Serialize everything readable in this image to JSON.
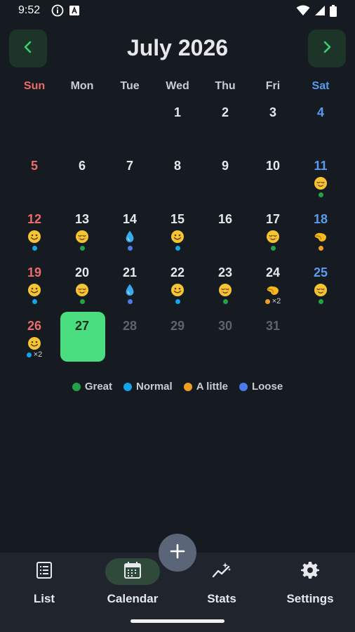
{
  "status": {
    "time": "9:52"
  },
  "header": {
    "title": "July 2026"
  },
  "weekdays": [
    "Sun",
    "Mon",
    "Tue",
    "Wed",
    "Thu",
    "Fri",
    "Sat"
  ],
  "colors": {
    "great": "#22a34a",
    "normal": "#14a5e8",
    "a_little": "#f0a020",
    "loose": "#4a7cf0",
    "today": "#4ade80"
  },
  "days": [
    {
      "day": "",
      "dow": 0
    },
    {
      "day": "",
      "dow": 1
    },
    {
      "day": "",
      "dow": 2
    },
    {
      "day": "1",
      "dow": 3
    },
    {
      "day": "2",
      "dow": 4
    },
    {
      "day": "3",
      "dow": 5
    },
    {
      "day": "4",
      "dow": 6
    },
    {
      "day": "5",
      "dow": 0
    },
    {
      "day": "6",
      "dow": 1
    },
    {
      "day": "7",
      "dow": 2
    },
    {
      "day": "8",
      "dow": 3
    },
    {
      "day": "9",
      "dow": 4
    },
    {
      "day": "10",
      "dow": 5
    },
    {
      "day": "11",
      "dow": 6,
      "emoji": "relieved",
      "dots": [
        "great"
      ]
    },
    {
      "day": "12",
      "dow": 0,
      "emoji": "smile",
      "dots": [
        "normal"
      ]
    },
    {
      "day": "13",
      "dow": 1,
      "emoji": "relieved",
      "dots": [
        "great"
      ]
    },
    {
      "day": "14",
      "dow": 2,
      "emoji": "droplet",
      "dots": [
        "loose"
      ]
    },
    {
      "day": "15",
      "dow": 3,
      "emoji": "smile",
      "dots": [
        "normal"
      ]
    },
    {
      "day": "16",
      "dow": 4
    },
    {
      "day": "17",
      "dow": 5,
      "emoji": "relieved",
      "dots": [
        "great"
      ]
    },
    {
      "day": "18",
      "dow": 6,
      "emoji": "pinch",
      "dots": [
        "a_little"
      ]
    },
    {
      "day": "19",
      "dow": 0,
      "emoji": "smile",
      "dots": [
        "normal"
      ]
    },
    {
      "day": "20",
      "dow": 1,
      "emoji": "relieved",
      "dots": [
        "great"
      ]
    },
    {
      "day": "21",
      "dow": 2,
      "emoji": "droplet",
      "dots": [
        "loose"
      ]
    },
    {
      "day": "22",
      "dow": 3,
      "emoji": "smile",
      "dots": [
        "normal"
      ]
    },
    {
      "day": "23",
      "dow": 4,
      "emoji": "relieved",
      "dots": [
        "great"
      ]
    },
    {
      "day": "24",
      "dow": 5,
      "emoji": "pinch",
      "dots": [
        "a_little"
      ],
      "count": "×2"
    },
    {
      "day": "25",
      "dow": 6,
      "emoji": "relieved",
      "dots": [
        "great"
      ]
    },
    {
      "day": "26",
      "dow": 0,
      "emoji": "smile",
      "dots": [
        "normal"
      ],
      "count": "×2"
    },
    {
      "day": "27",
      "dow": 1,
      "today": true
    },
    {
      "day": "28",
      "dow": 2,
      "future": true
    },
    {
      "day": "29",
      "dow": 3,
      "future": true
    },
    {
      "day": "30",
      "dow": 4,
      "future": true
    },
    {
      "day": "31",
      "dow": 5,
      "future": true
    }
  ],
  "legend": [
    {
      "key": "great",
      "label": "Great"
    },
    {
      "key": "normal",
      "label": "Normal"
    },
    {
      "key": "a_little",
      "label": "A little"
    },
    {
      "key": "loose",
      "label": "Loose"
    }
  ],
  "bottom_nav": {
    "items": [
      {
        "label": "List",
        "icon": "list-icon"
      },
      {
        "label": "Calendar",
        "icon": "calendar-icon",
        "active": true
      },
      {
        "label": "Stats",
        "icon": "stats-icon"
      },
      {
        "label": "Settings",
        "icon": "gear-icon"
      }
    ]
  }
}
